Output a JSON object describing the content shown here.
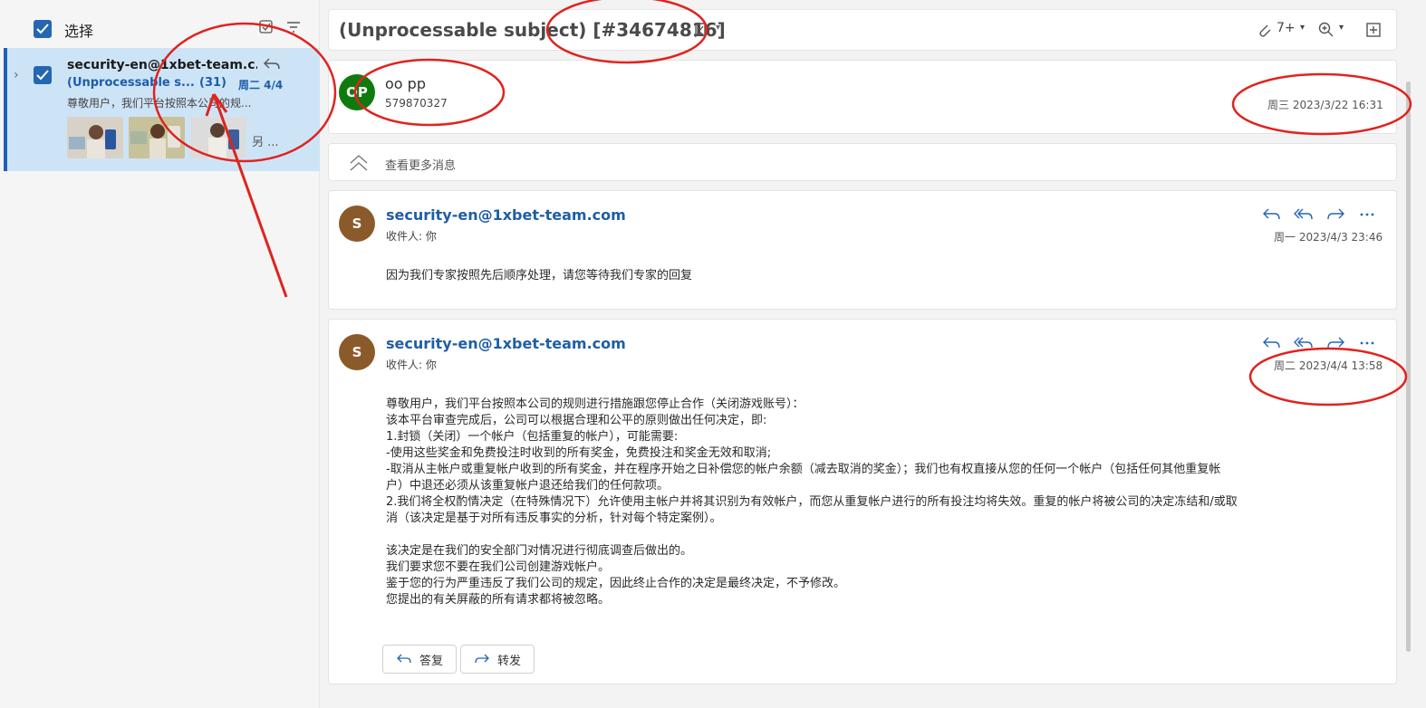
{
  "list": {
    "select_label": "选择",
    "item": {
      "from": "security-en@1xbet-team.c...",
      "subject": "(Unprocessable s...",
      "count": "(31)",
      "date": "周二 4/4",
      "preview": "尊敬用户，我们平台按照本公司的规...",
      "more": "另 ..."
    }
  },
  "thread": {
    "subject": "(Unprocessable subject) [#34674816]",
    "zoom_count": "7+",
    "first": {
      "initials": "OP",
      "name": "oo pp",
      "sub": "579870327",
      "date": "周三 2023/3/22 16:31",
      "avatar_color": "#0f7b0f"
    },
    "see_more": "查看更多消息",
    "msg1": {
      "initials": "S",
      "sender": "security-en@1xbet-team.com",
      "to": "收件人: 你",
      "date": "周一 2023/4/3 23:46",
      "body": "因为我们专家按照先后顺序处理，请您等待我们专家的回复",
      "avatar_color": "#8b5a2b"
    },
    "msg2": {
      "initials": "S",
      "sender": "security-en@1xbet-team.com",
      "to": "收件人: 你",
      "date": "周二 2023/4/4 13:58",
      "avatar_color": "#8b5a2b",
      "lines": [
        "尊敬用户，我们平台按照本公司的规则进行措施跟您停止合作（关闭游戏账号）：",
        "该本平台审查完成后，公司可以根据合理和公平的原则做出任何决定，即:",
        "1.封锁（关闭）一个帐户（包括重复的帐户），可能需要:",
        "-使用这些奖金和免费投注时收到的所有奖金，免费投注和奖金无效和取消;",
        "-取消从主帐户或重复帐户收到的所有奖金，并在程序开始之日补偿您的帐户余额（减去取消的奖金）；我们也有权直接从您的任何一个帐户（包括任何其他重复帐",
        "户）中退还必须从该重复帐户退还给我们的任何款项。",
        "2.我们将全权酌情决定（在特殊情况下）允许使用主帐户并将其识别为有效帐户，而您从重复帐户进行的所有投注均将失效。重复的帐户将被公司的决定冻结和/或取",
        "消（该决定是基于对所有违反事实的分析，针对每个特定案例）。",
        "",
        "该决定是在我们的安全部门对情况进行彻底调查后做出的。",
        "我们要求您不要在我们公司创建游戏帐户。",
        "鉴于您的行为严重违反了我们公司的规定，因此终止合作的决定是最终决定，不予修改。",
        "您提出的有关屏蔽的所有请求都将被忽略。"
      ],
      "reply_label": "答复",
      "forward_label": "转发"
    }
  },
  "colors": {
    "accent": "#1f61b3",
    "selected_bg": "#cde4f7",
    "annotation": "#e0231e"
  }
}
